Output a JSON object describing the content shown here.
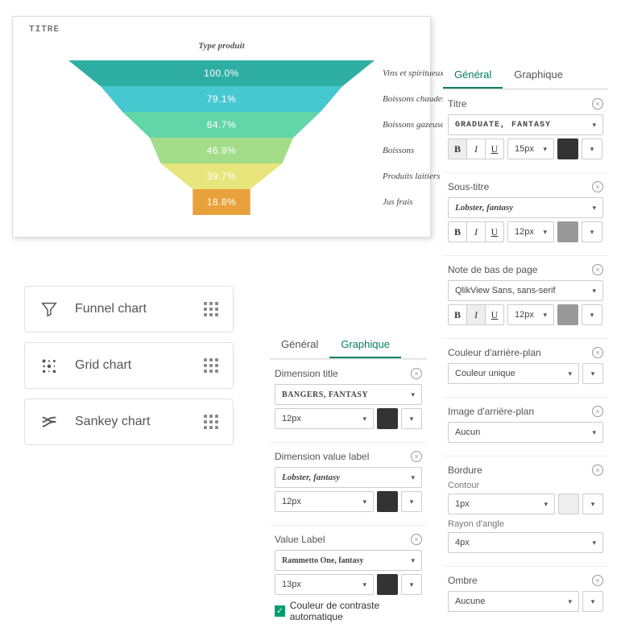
{
  "chart": {
    "title": "Titre",
    "subtitle": "Type produit"
  },
  "chart_data": {
    "type": "funnel",
    "dimension": "Type produit",
    "series": [
      {
        "label": "Vins et spiritueux",
        "value": 100.0,
        "display": "100.0%",
        "color": "#2eaea3"
      },
      {
        "label": "Boissons chaudes",
        "value": 79.1,
        "display": "79.1%",
        "color": "#46c8d1"
      },
      {
        "label": "Boissons gazeuses",
        "value": 64.7,
        "display": "64.7%",
        "color": "#63d6a9"
      },
      {
        "label": "Boissons",
        "value": 46.9,
        "display": "46.9%",
        "color": "#a3dd8a"
      },
      {
        "label": "Produits laitiers",
        "value": 39.7,
        "display": "39.7%",
        "color": "#e7e57b"
      },
      {
        "label": "Jus frais",
        "value": 18.8,
        "display": "18.8%",
        "color": "#e9a13b"
      }
    ]
  },
  "chartTypes": [
    {
      "name": "Funnel chart"
    },
    {
      "name": "Grid chart"
    },
    {
      "name": "Sankey chart"
    }
  ],
  "midPanel": {
    "tabs": {
      "general": "Général",
      "graphique": "Graphique"
    },
    "dimTitle": {
      "label": "Dimension title",
      "font": "Bangers, fantasy",
      "size": "12px"
    },
    "dimValue": {
      "label": "Dimension value label",
      "font": "Lobster, fantasy",
      "size": "12px"
    },
    "valueLabel": {
      "label": "Value Label",
      "font": "Rammetto One, fantasy",
      "size": "13px"
    },
    "contrast": "Couleur de contraste automatique"
  },
  "rightPanel": {
    "tabs": {
      "general": "Général",
      "graphique": "Graphique"
    },
    "titre": {
      "label": "Titre",
      "font": "Graduate, fantasy",
      "size": "15px"
    },
    "sousTitre": {
      "label": "Sous-titre",
      "font": "Lobster, fantasy",
      "size": "12px"
    },
    "note": {
      "label": "Note de bas de page",
      "font": "QlikView Sans, sans-serif",
      "size": "12px"
    },
    "bgColor": {
      "label": "Couleur d'arrière-plan",
      "value": "Couleur unique"
    },
    "bgImage": {
      "label": "Image d'arrière-plan",
      "value": "Aucun"
    },
    "bordure": {
      "label": "Bordure",
      "contour": "Contour",
      "contourVal": "1px",
      "rayon": "Rayon d'angle",
      "rayonVal": "4px"
    },
    "ombre": {
      "label": "Ombre",
      "value": "Aucune"
    }
  }
}
